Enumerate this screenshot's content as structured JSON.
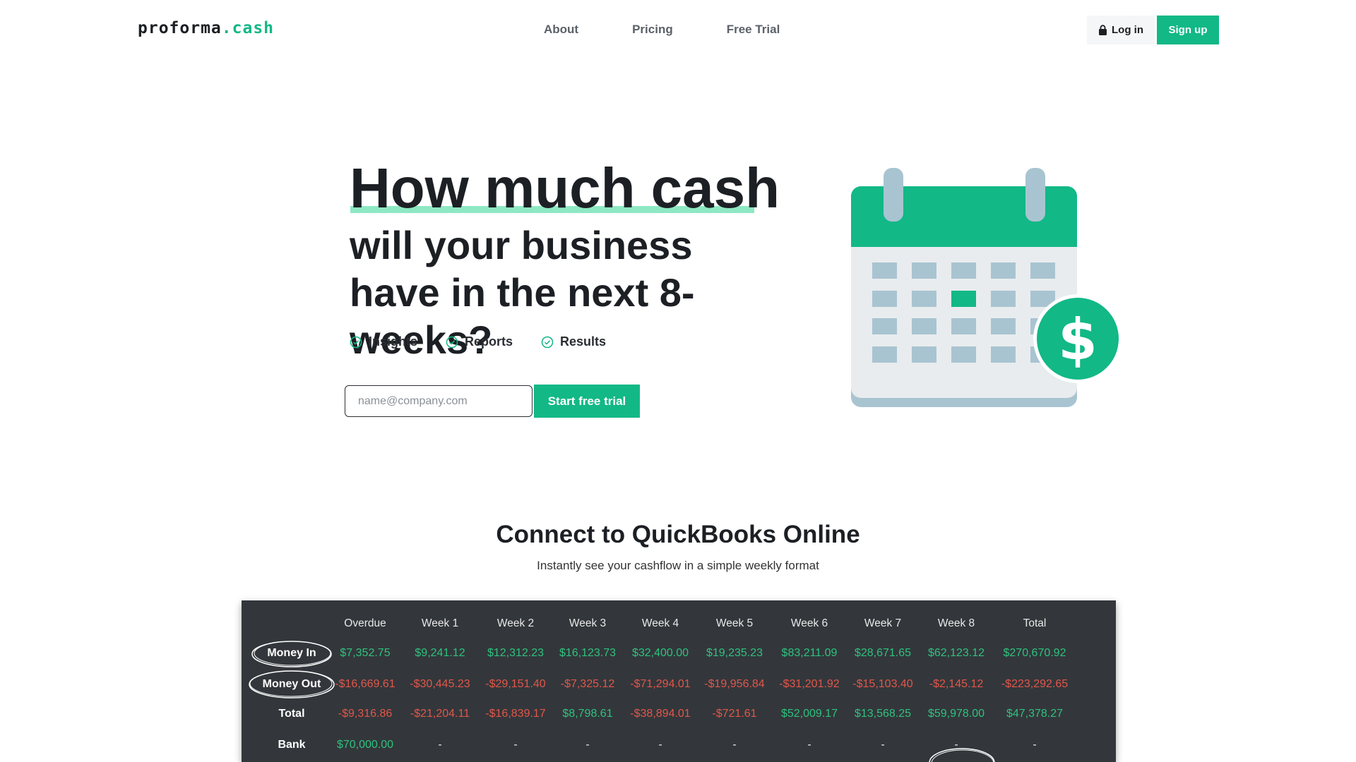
{
  "nav": {
    "logo_main": "proforma",
    "logo_accent": ".cash",
    "links": [
      "About",
      "Pricing",
      "Free Trial"
    ],
    "login_label": "Log in",
    "signup_label": "Sign up"
  },
  "hero": {
    "title": "How much cash",
    "subtitle": "will your business have in the next 8-weeks?",
    "features": [
      "Insights",
      "Reports",
      "Results"
    ],
    "email_placeholder": "name@company.com",
    "cta_label": "Start free trial"
  },
  "connect": {
    "title": "Connect to QuickBooks Online",
    "subtitle": "Instantly see your cashflow in a simple weekly format"
  },
  "cashflow": {
    "headers": [
      "Overdue",
      "Week 1",
      "Week 2",
      "Week 3",
      "Week 4",
      "Week 5",
      "Week 6",
      "Week 7",
      "Week 8",
      "Total"
    ],
    "rows": [
      {
        "label": "Money In",
        "values": [
          "$7,352.75",
          "$9,241.12",
          "$12,312.23",
          "$16,123.73",
          "$32,400.00",
          "$19,235.23",
          "$83,211.09",
          "$28,671.65",
          "$62,123.12",
          "$270,670.92"
        ]
      },
      {
        "label": "Money Out",
        "values": [
          "-$16,669.61",
          "-$30,445.23",
          "-$29,151.40",
          "-$7,325.12",
          "-$71,294.01",
          "-$19,956.84",
          "-$31,201.92",
          "-$15,103.40",
          "-$2,145.12",
          "-$223,292.65"
        ]
      },
      {
        "label": "Total",
        "values": [
          "-$9,316.86",
          "-$21,204.11",
          "-$16,839.17",
          "$8,798.61",
          "-$38,894.01",
          "-$721.61",
          "$52,009.17",
          "$13,568.25",
          "$59,978.00",
          "$47,378.27"
        ]
      },
      {
        "label": "Bank",
        "values": [
          "$70,000.00",
          "-",
          "-",
          "-",
          "-",
          "-",
          "-",
          "-",
          "-",
          "-"
        ]
      }
    ]
  },
  "colors": {
    "brand": "#12b886",
    "positive": "#2ec27e",
    "negative": "#e2564a",
    "panel": "#33373b"
  }
}
